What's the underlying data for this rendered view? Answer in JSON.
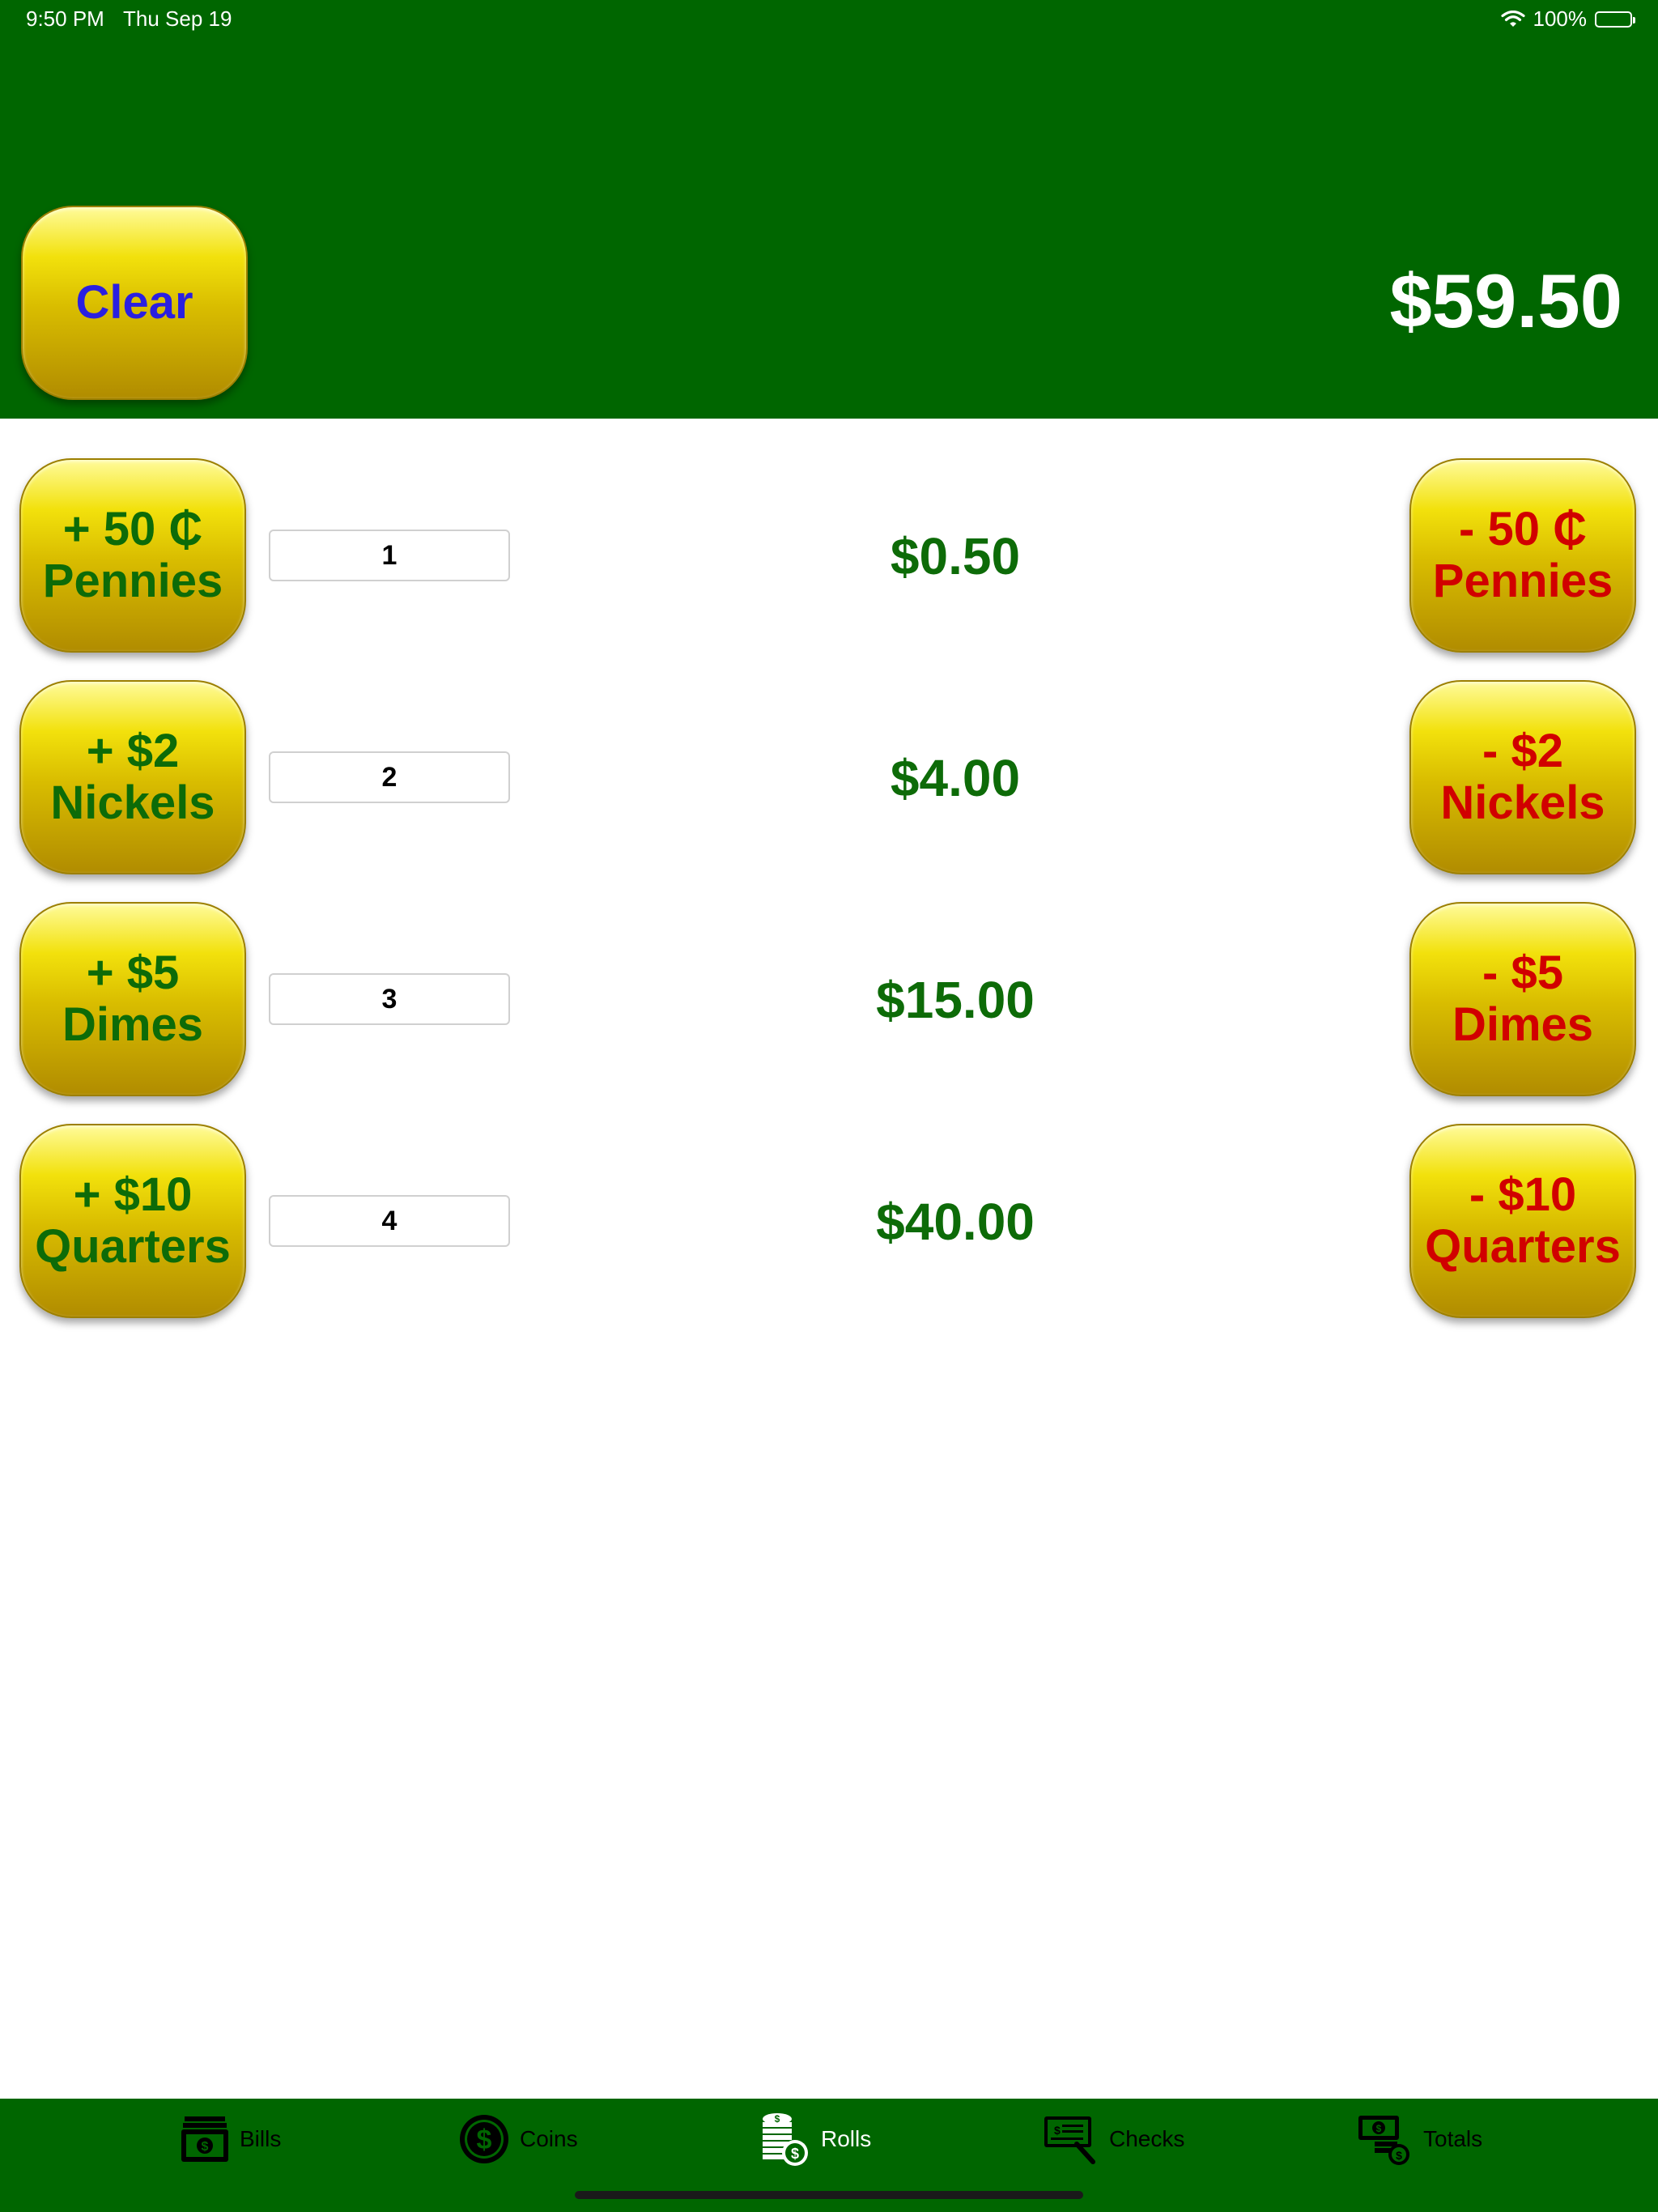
{
  "status_bar": {
    "time": "9:50 PM",
    "date": "Thu Sep 19",
    "battery": "100%",
    "icons": [
      "wifi-icon",
      "battery-icon"
    ]
  },
  "header": {
    "clear_label": "Clear",
    "total": "$59.50"
  },
  "rows": [
    {
      "add_amount": "+ 50 ₵",
      "add_coin": "Pennies",
      "quantity": "1",
      "value": "$0.50",
      "sub_amount": "- 50 ₵",
      "sub_coin": "Pennies"
    },
    {
      "add_amount": "+ $2",
      "add_coin": "Nickels",
      "quantity": "2",
      "value": "$4.00",
      "sub_amount": "- $2",
      "sub_coin": "Nickels"
    },
    {
      "add_amount": "+ $5",
      "add_coin": "Dimes",
      "quantity": "3",
      "value": "$15.00",
      "sub_amount": "- $5",
      "sub_coin": "Dimes"
    },
    {
      "add_amount": "+ $10",
      "add_coin": "Quarters",
      "quantity": "4",
      "value": "$40.00",
      "sub_amount": "- $10",
      "sub_coin": "Quarters"
    }
  ],
  "tabs": [
    {
      "label": "Bills",
      "icon": "bills-icon",
      "active": false
    },
    {
      "label": "Coins",
      "icon": "coin-icon",
      "active": false
    },
    {
      "label": "Rolls",
      "icon": "coin-rolls-icon",
      "active": true
    },
    {
      "label": "Checks",
      "icon": "check-icon",
      "active": false
    },
    {
      "label": "Totals",
      "icon": "totals-icon",
      "active": false
    }
  ],
  "colors": {
    "header_green": "#006600",
    "plus_text": "#0d6b08",
    "minus_text": "#d10000",
    "clear_text": "#2a1fe0",
    "active_tab": "#ffffff"
  }
}
